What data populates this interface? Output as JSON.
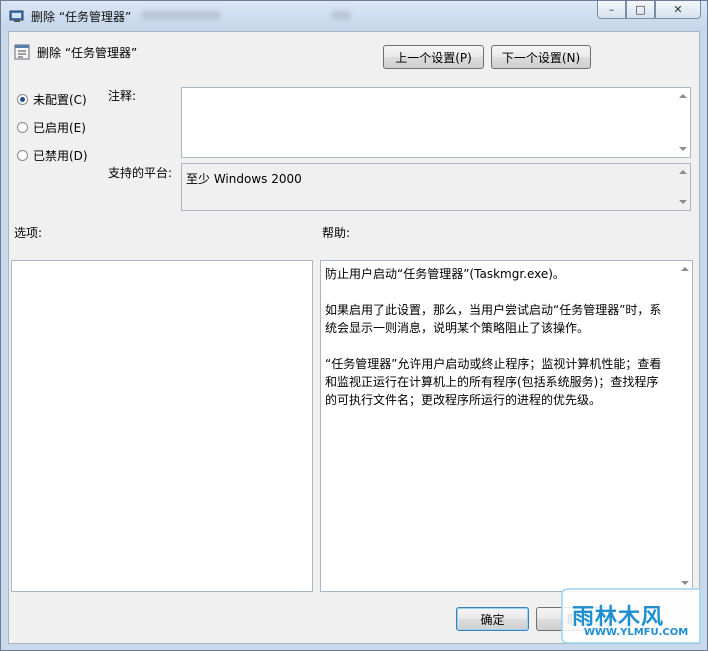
{
  "window": {
    "title": "删除 “任务管理器”",
    "buttons": {
      "minimize": "–",
      "maximize": "□",
      "close": "✕"
    }
  },
  "header": {
    "title": "删除 “任务管理器”"
  },
  "nav": {
    "prev_label": "上一个设置(P)",
    "next_label": "下一个设置(N)"
  },
  "state": {
    "options": [
      {
        "label": "未配置(C)",
        "checked": true
      },
      {
        "label": "已启用(E)",
        "checked": false
      },
      {
        "label": "已禁用(D)",
        "checked": false
      }
    ]
  },
  "comment": {
    "label": "注释:",
    "value": ""
  },
  "platform": {
    "label": "支持的平台:",
    "value": "至少 Windows 2000"
  },
  "options_panel": {
    "label": "选项:"
  },
  "help_panel": {
    "label": "帮助:",
    "paragraphs": [
      "防止用户启动“任务管理器”(Taskmgr.exe)。",
      "如果启用了此设置，那么，当用户尝试启动“任务管理器”时，系统会显示一则消息，说明某个策略阻止了该操作。",
      " “任务管理器”允许用户启动或终止程序；监视计算机性能；查看和监视正运行在计算机上的所有程序(包括系统服务)；查找程序的可执行文件名；更改程序所运行的进程的优先级。"
    ]
  },
  "footer": {
    "ok_label": "确定",
    "cancel_label": "取"
  },
  "watermark": {
    "text": "雨林木风",
    "url": "WWW.YLMFU.COM"
  }
}
